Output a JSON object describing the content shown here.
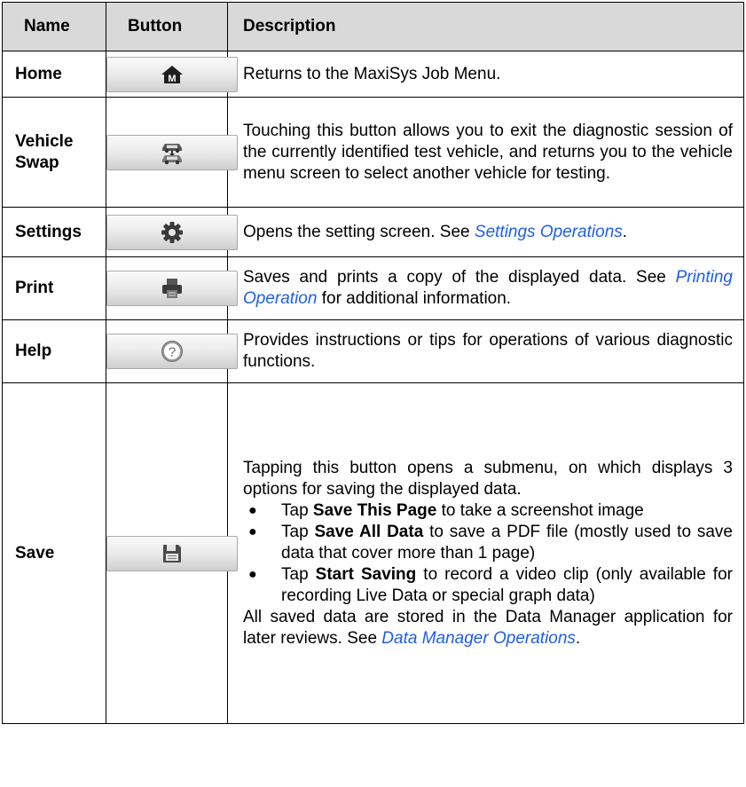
{
  "headers": {
    "name": "Name",
    "button": "Button",
    "description": "Description"
  },
  "rows": {
    "home": {
      "name": "Home",
      "icon": "home-m-icon",
      "desc": "Returns to the MaxiSys Job Menu."
    },
    "vehicle_swap": {
      "name_line1": "Vehicle",
      "name_line2": "Swap",
      "icon": "vehicle-swap-icon",
      "desc": "Touching this button allows you to exit the diagnostic session of the currently identified test vehicle, and returns you to the vehicle menu screen to select another vehicle for testing."
    },
    "settings": {
      "name": "Settings",
      "icon": "gear-icon",
      "desc_pre": "Opens the setting screen. See ",
      "desc_link": "Settings Operations",
      "desc_post": "."
    },
    "print": {
      "name": "Print",
      "icon": "printer-icon",
      "desc_pre": "Saves and prints a copy of the displayed data. See ",
      "desc_link": "Printing Operation",
      "desc_post": " for additional information."
    },
    "help": {
      "name": "Help",
      "icon": "help-icon",
      "desc": "Provides instructions or tips for operations of various diagnostic functions."
    },
    "save": {
      "name": "Save",
      "icon": "floppy-disk-icon",
      "desc_intro": "Tapping this button opens a submenu, on which displays 3 options for saving the displayed data.",
      "bullet_glyph": "●",
      "options": [
        {
          "pre": "Tap ",
          "bold": "Save This Page",
          "post": " to take a screenshot image"
        },
        {
          "pre": "Tap ",
          "bold": "Save All Data",
          "post": " to save a PDF file (mostly used to save data that cover more than 1 page)"
        },
        {
          "pre": "Tap ",
          "bold": "Start Saving",
          "post": " to record a video clip (only available for recording Live Data or special graph data)"
        }
      ],
      "desc_outro_pre": "All saved data are stored in the Data Manager application for later reviews. See ",
      "desc_outro_link": "Data Manager Operations",
      "desc_outro_post": "."
    }
  }
}
